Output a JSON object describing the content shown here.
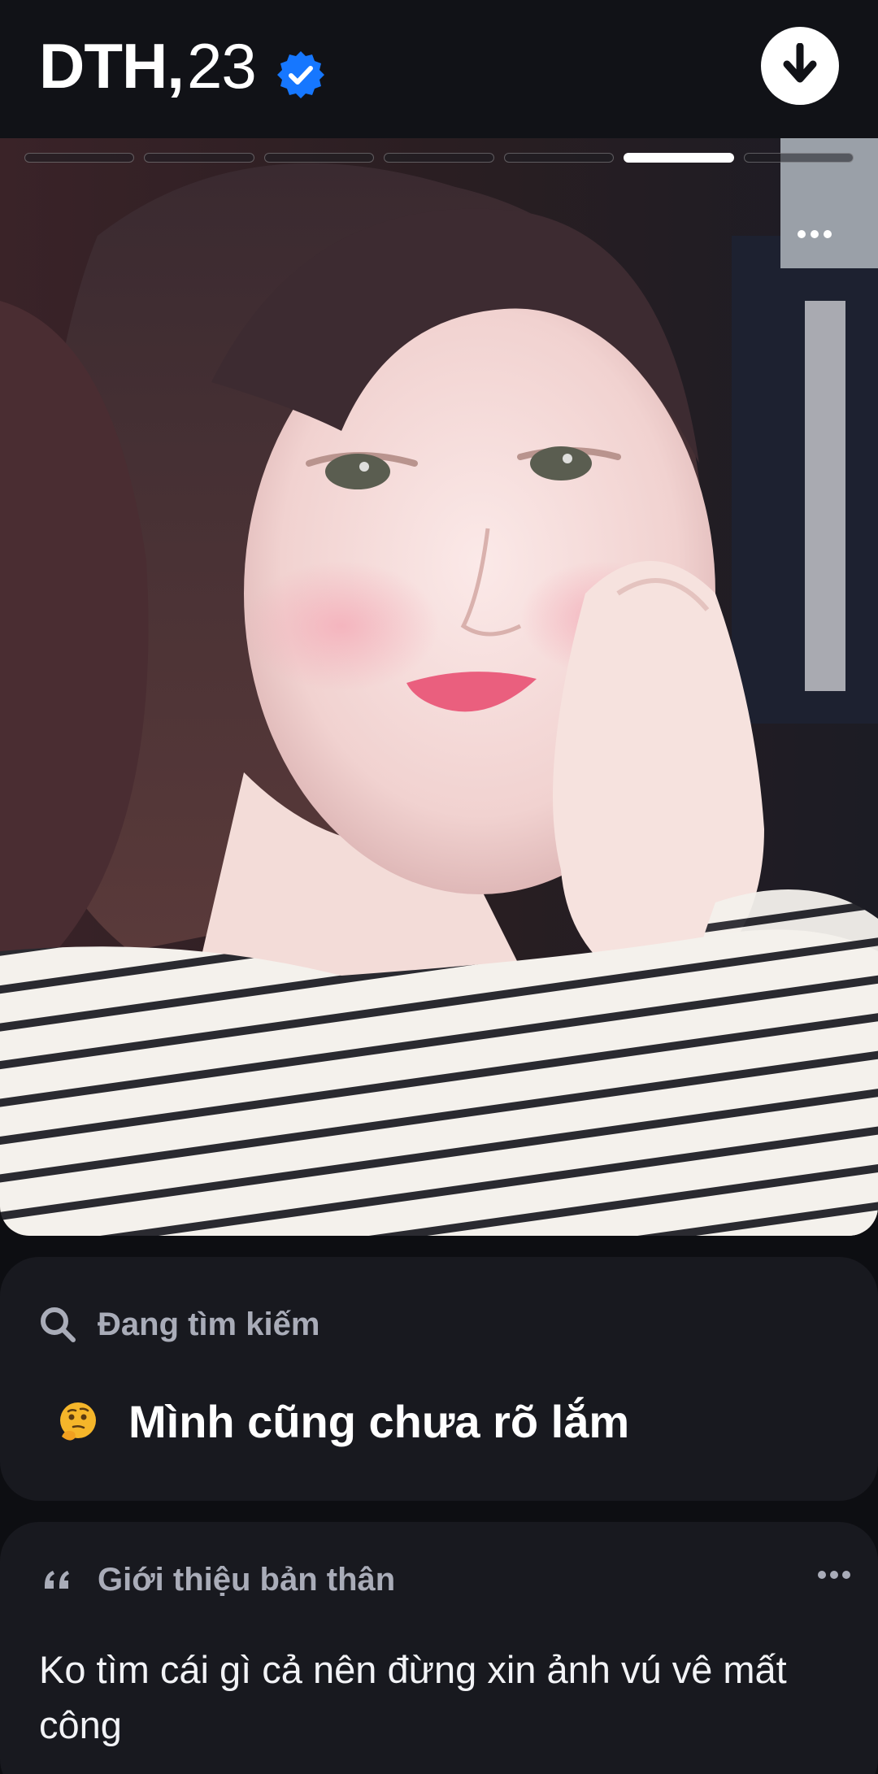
{
  "header": {
    "name": "DTH,",
    "age": "23",
    "accent_color": "#1677ff"
  },
  "photo": {
    "segment_count": 7,
    "active_index": 5,
    "more_icon": "ellipsis-icon"
  },
  "looking_for": {
    "icon": "search-icon",
    "label": "Đang tìm kiếm",
    "emoji_icon": "thinking-face-icon",
    "value": "Mình cũng chưa rõ lắm"
  },
  "bio": {
    "icon": "quote-icon",
    "label": "Giới thiệu bản thân",
    "text": "Ko tìm cái gì cả nên đừng xin ảnh vú vê mất công"
  }
}
